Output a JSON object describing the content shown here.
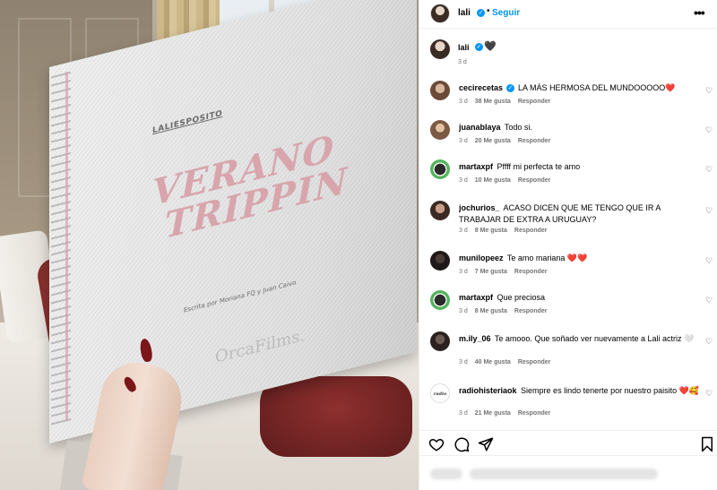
{
  "post": {
    "photo": {
      "booklet_author": "LALIESPOSITO",
      "booklet_title_line1": "VERANO",
      "booklet_title_line2": "TRIPPIN",
      "booklet_subtitle": "",
      "booklet_credit": "Escrita por Moriana FQ y Juan Caivo",
      "booklet_brand": "OrcaFilms."
    },
    "header": {
      "username": "lali",
      "separator": "•",
      "follow_label": "Seguir",
      "more_label": "•••"
    },
    "caption": {
      "username": "lali",
      "text": "🖤",
      "time": "3 d"
    },
    "comments": [
      {
        "user": "cecirecetas",
        "verified": true,
        "text": "LA MÁS HERMOSA DEL MUNDOOOOO",
        "emoji": "❤️",
        "time": "3 d",
        "likes": "38 Me gusta",
        "reply": "Responder"
      },
      {
        "user": "juanablaya",
        "text": "Todo si.",
        "time": "3 d",
        "likes": "20 Me gusta",
        "reply": "Responder"
      },
      {
        "user": "martaxpf",
        "text": "Pffff mi perfecta te amo",
        "time": "3 d",
        "likes": "10 Me gusta",
        "reply": "Responder"
      },
      {
        "user": "jochurios_",
        "text": "ACASO DICEN QUE ME TENGO QUE IR A TRABAJAR DE EXTRA A URUGUAY?",
        "time": "3 d",
        "likes": "8 Me gusta",
        "reply": "Responder"
      },
      {
        "user": "munilopeez",
        "text": "Te amo mariana",
        "emoji": "❤️❤️",
        "time": "3 d",
        "likes": "7 Me gusta",
        "reply": "Responder"
      },
      {
        "user": "martaxpf",
        "text": "Que preciosa",
        "time": "3 d",
        "likes": "8 Me gusta",
        "reply": "Responder"
      },
      {
        "user": "m.ily_06",
        "text": "Te amooo. Que soñado ver nuevamente a Lali actriz",
        "emoji": "🤍",
        "time": "3 d",
        "likes": "40 Me gusta",
        "reply": "Responder"
      },
      {
        "user": "radiohisteriaok",
        "text": "Siempre es lindo tenerte por nuestro paisito",
        "emoji": "❤️🥰",
        "time": "3 d",
        "likes": "21 Me gusta",
        "reply": "Responder"
      }
    ],
    "actions": {
      "like_icon": "heart-outline-icon",
      "comment_icon": "comment-icon",
      "share_icon": "share-icon",
      "save_icon": "bookmark-icon"
    }
  }
}
